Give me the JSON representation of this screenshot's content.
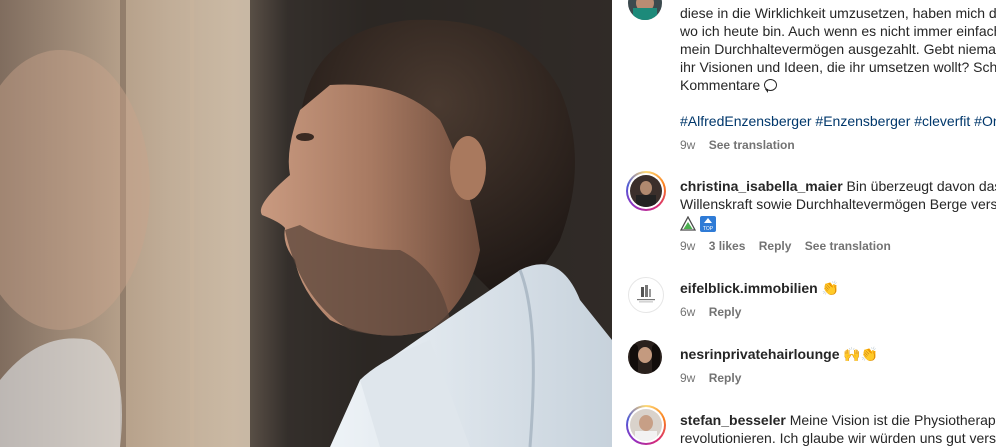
{
  "caption": {
    "lines": [
      "diese in die Wirklichkeit umzusetzen, haben mich da",
      "wo ich heute bin. Auch wenn es nicht immer einfach",
      "mein Durchhaltevermögen ausgezahlt. Gebt niemal",
      "ihr Visionen und Ideen, die ihr umsetzen wollt? Schr",
      "Kommentare"
    ],
    "hashtags": "#AlfredEnzensberger #Enzensberger #cleverfit #On",
    "time": "9w",
    "see_translation": "See translation"
  },
  "comments": [
    {
      "username": "christina_isabella_maier",
      "text_line1": "Bin überzeugt davon das m",
      "text_line2": "Willenskraft sowie Durchhaltevermögen Berge vers",
      "emoji_line": "⚠️🔝",
      "time": "9w",
      "likes": "3 likes",
      "reply": "Reply",
      "see_translation": "See translation"
    },
    {
      "username": "eifelblick.immobilien",
      "text_line1": "👏",
      "time": "6w",
      "reply": "Reply"
    },
    {
      "username": "nesrinprivatehairlounge",
      "text_line1": "🙌👏",
      "time": "9w",
      "reply": "Reply"
    },
    {
      "username": "stefan_besseler",
      "text_line1": "Meine Vision ist die Physiotherapie",
      "text_line2": "revolutionieren. Ich glaube wir würden uns gut vers"
    }
  ],
  "colors": {
    "link": "#00376b",
    "muted": "#737373",
    "text": "#262626"
  },
  "icons": [
    "comment-bubble-icon",
    "warning-emoji-icon",
    "top-emoji-icon",
    "clap-emoji-icon",
    "raised-hands-emoji-icon"
  ]
}
